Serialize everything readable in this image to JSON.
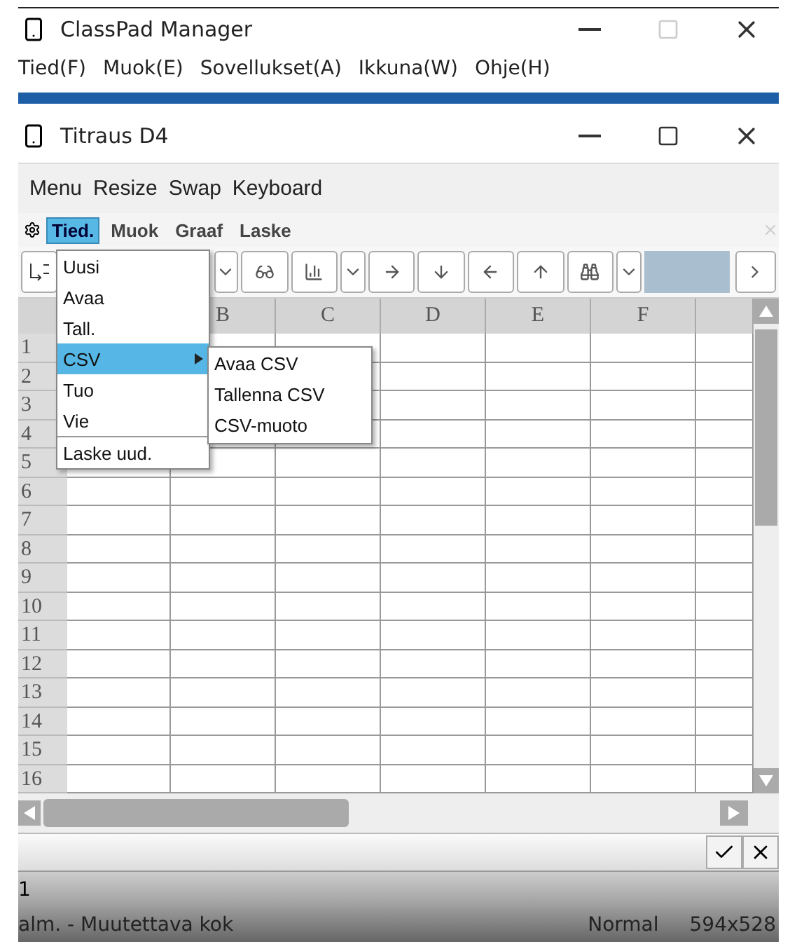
{
  "main_window": {
    "title": "ClassPad Manager",
    "maximize_enabled": false,
    "menu": [
      "Tied(F)",
      "Muok(E)",
      "Sovellukset(A)",
      "Ikkuna(W)",
      "Ohje(H)"
    ]
  },
  "document_window": {
    "title": "Titraus D4",
    "maximize_enabled": true,
    "app_menu": [
      "Menu",
      "Resize",
      "Swap",
      "Keyboard"
    ],
    "tabs": [
      {
        "label": "Tied.",
        "selected": true
      },
      {
        "label": "Muok",
        "selected": false
      },
      {
        "label": "Graaf",
        "selected": false
      },
      {
        "label": "Laske",
        "selected": false
      }
    ],
    "spreadsheet": {
      "columns": [
        "B",
        "C",
        "D",
        "E",
        "F"
      ],
      "rows": [
        "1",
        "2",
        "3",
        "4",
        "5",
        "6",
        "7",
        "8",
        "9",
        "10",
        "11",
        "12",
        "13",
        "14",
        "15",
        "16"
      ]
    },
    "dropdown": [
      {
        "label": "Uusi",
        "selected": false,
        "submenu": false
      },
      {
        "label": "Avaa",
        "selected": false,
        "submenu": false
      },
      {
        "label": "Tall.",
        "selected": false,
        "submenu": false
      },
      {
        "label": "CSV",
        "selected": true,
        "submenu": true
      },
      {
        "label": "Tuo",
        "selected": false,
        "submenu": false
      },
      {
        "label": "Vie",
        "selected": false,
        "submenu": false
      },
      {
        "label": "Laske uud.",
        "selected": false,
        "submenu": false
      }
    ],
    "submenu": [
      "Avaa CSV",
      "Tallenna CSV",
      "CSV-muoto"
    ],
    "cell_ref": "1"
  },
  "status_bar": {
    "message": "alm. - Muutettava kok",
    "mode": "Normal",
    "size": "594x528"
  }
}
